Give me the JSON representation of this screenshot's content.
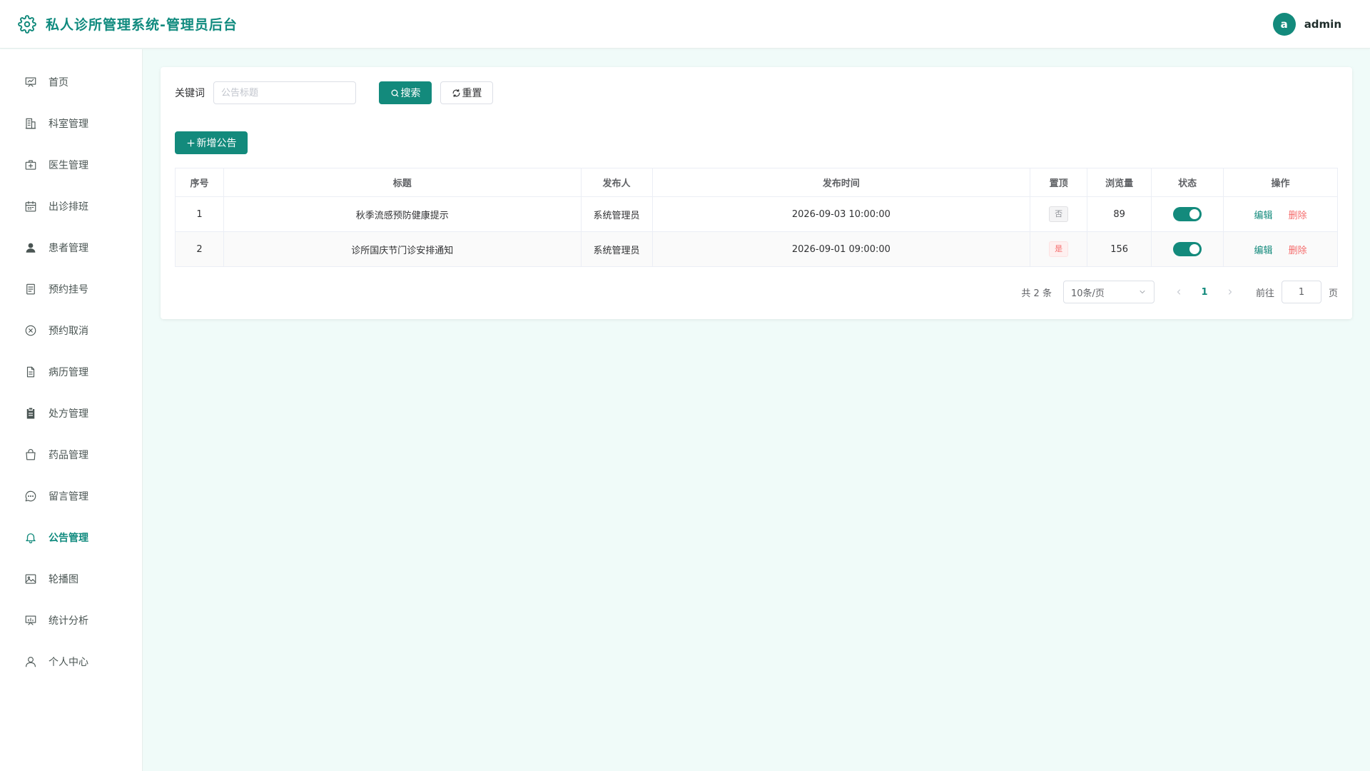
{
  "header": {
    "title": "私人诊所管理系统-管理员后台",
    "brand_icon": "gear-icon",
    "avatar_letter": "a",
    "username": "admin"
  },
  "colors": {
    "primary": "#138a7c",
    "danger": "#f56c6c",
    "page_bg": "#f0fbf9"
  },
  "sidebar": {
    "items": [
      {
        "label": "首页",
        "icon": "presentation-icon",
        "active": false
      },
      {
        "label": "科室管理",
        "icon": "building-icon",
        "active": false
      },
      {
        "label": "医生管理",
        "icon": "medical-bag-icon",
        "active": false
      },
      {
        "label": "出诊排班",
        "icon": "calendar-icon",
        "active": false
      },
      {
        "label": "患者管理",
        "icon": "user-filled-icon",
        "active": false
      },
      {
        "label": "预约挂号",
        "icon": "document-icon",
        "active": false
      },
      {
        "label": "预约取消",
        "icon": "circle-close-icon",
        "active": false
      },
      {
        "label": "病历管理",
        "icon": "file-icon",
        "active": false
      },
      {
        "label": "处方管理",
        "icon": "clipboard-icon",
        "active": false
      },
      {
        "label": "药品管理",
        "icon": "shopping-bag-icon",
        "active": false
      },
      {
        "label": "留言管理",
        "icon": "chat-icon",
        "active": false
      },
      {
        "label": "公告管理",
        "icon": "bell-icon",
        "active": true
      },
      {
        "label": "轮播图",
        "icon": "picture-icon",
        "active": false
      },
      {
        "label": "统计分析",
        "icon": "chart-board-icon",
        "active": false
      },
      {
        "label": "个人中心",
        "icon": "user-outline-icon",
        "active": false
      }
    ]
  },
  "search": {
    "label": "关键词",
    "placeholder": "公告标题",
    "value": "",
    "search_button": "搜索",
    "reset_button": "重置"
  },
  "toolbar": {
    "add_button": "新增公告"
  },
  "table": {
    "columns": [
      "序号",
      "标题",
      "发布人",
      "发布时间",
      "置顶",
      "浏览量",
      "状态",
      "操作"
    ],
    "rows": [
      {
        "index": "1",
        "title": "秋季流感预防健康提示",
        "publisher": "系统管理员",
        "time": "2026-09-03 10:00:00",
        "pinned": "否",
        "pinned_flag": false,
        "views": "89",
        "status_on": true,
        "edit": "编辑",
        "delete": "删除"
      },
      {
        "index": "2",
        "title": "诊所国庆节门诊安排通知",
        "publisher": "系统管理员",
        "time": "2026-09-01 09:00:00",
        "pinned": "是",
        "pinned_flag": true,
        "views": "156",
        "status_on": true,
        "edit": "编辑",
        "delete": "删除"
      }
    ]
  },
  "pagination": {
    "total_text": "共 2 条",
    "page_size": "10条/页",
    "current_page": "1",
    "goto_label": "前往",
    "goto_value": "1",
    "goto_unit": "页"
  }
}
